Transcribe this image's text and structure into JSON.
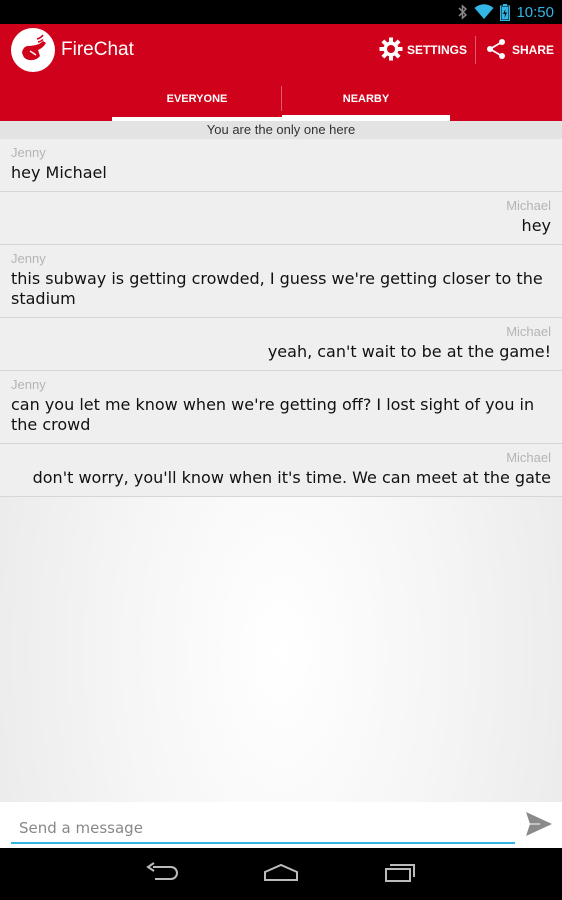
{
  "status_bar": {
    "time": "10:50"
  },
  "app": {
    "title": "FireChat"
  },
  "actions": {
    "settings_label": "SETTINGS",
    "share_label": "SHARE"
  },
  "tabs": [
    {
      "label": "EVERYONE",
      "selected": false
    },
    {
      "label": "NEARBY",
      "selected": true
    }
  ],
  "notice": "You are the only one here",
  "messages": [
    {
      "author": "Jenny",
      "text": "hey Michael",
      "align": "left"
    },
    {
      "author": "Michael",
      "text": "hey",
      "align": "right"
    },
    {
      "author": "Jenny",
      "text": "this subway is getting crowded, I guess we're getting closer to the stadium",
      "align": "left"
    },
    {
      "author": "Michael",
      "text": "yeah, can't wait to be at the game!",
      "align": "right"
    },
    {
      "author": "Jenny",
      "text": "can you let me know when we're getting off? I lost sight of you in the crowd",
      "align": "left"
    },
    {
      "author": "Michael",
      "text": "don't worry, you'll know when it's time. We can meet at the gate",
      "align": "right"
    }
  ],
  "composer": {
    "placeholder": "Send a message"
  },
  "colors": {
    "brand": "#d0021b",
    "accent": "#33b5e5"
  },
  "icons": {
    "status": [
      "bluetooth-icon",
      "wifi-icon",
      "battery-icon"
    ],
    "settings": "gear-icon",
    "share": "share-icon",
    "send": "send-icon",
    "nav": [
      "back-icon",
      "home-icon",
      "recents-icon"
    ]
  }
}
